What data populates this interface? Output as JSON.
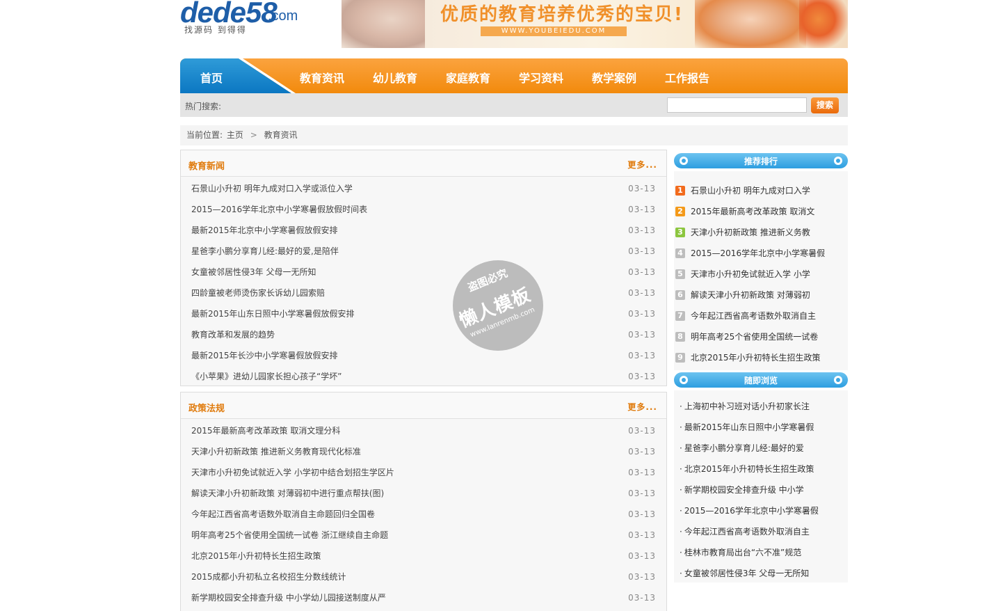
{
  "logo": {
    "brand": "dede58",
    "suffix": ".com",
    "slogan": "找源码 到得得"
  },
  "banner": {
    "headline": "优质的教育培养优秀的宝贝!",
    "url": "WWW.YOUBEIEDU.COM"
  },
  "nav": {
    "home": "首页",
    "items": [
      "教育资讯",
      "幼儿教育",
      "家庭教育",
      "学习资料",
      "教学案例",
      "工作报告"
    ]
  },
  "search": {
    "hot_label": "热门搜索:",
    "query": "",
    "button": "搜索"
  },
  "breadcrumb": {
    "prefix": "当前位置:",
    "home": "主页",
    "current": "教育资讯"
  },
  "news": {
    "title": "教育新闻",
    "more": "更多...",
    "items": [
      {
        "title": "石景山小升初 明年九成对口入学或派位入学",
        "date": "03-13"
      },
      {
        "title": "2015—2016学年北京中小学寒暑假放假时间表",
        "date": "03-13"
      },
      {
        "title": "最新2015年北京中小学寒暑假放假安排",
        "date": "03-13"
      },
      {
        "title": "星爸李小鹏分享育儿经:最好的爱,是陪伴",
        "date": "03-13"
      },
      {
        "title": "女童被邻居性侵3年 父母一无所知",
        "date": "03-13"
      },
      {
        "title": "四龄童被老师烫伤家长诉幼儿园索赔",
        "date": "03-13"
      },
      {
        "title": "最新2015年山东日照中小学寒暑假放假安排",
        "date": "03-13"
      },
      {
        "title": "教育改革和发展的趋势",
        "date": "03-13"
      },
      {
        "title": "最新2015年长沙中小学寒暑假放假安排",
        "date": "03-13"
      },
      {
        "title": "《小苹果》进幼儿园家长担心孩子“学坏”",
        "date": "03-13"
      }
    ]
  },
  "policy": {
    "title": "政策法规",
    "more": "更多...",
    "items": [
      {
        "title": "2015年最新高考改革政策 取消文理分科",
        "date": "03-13"
      },
      {
        "title": "天津小升初新政策 推进新义务教育现代化标准",
        "date": "03-13"
      },
      {
        "title": "天津市小升初免试就近入学 小学初中结合划招生学区片",
        "date": "03-13"
      },
      {
        "title": "解读天津小升初新政策 对薄弱初中进行重点帮扶(图)",
        "date": "03-13"
      },
      {
        "title": "今年起江西省高考语数外取消自主命题回归全国卷",
        "date": "03-13"
      },
      {
        "title": "明年高考25个省使用全国统一试卷 浙江继续自主命题",
        "date": "03-13"
      },
      {
        "title": "北京2015年小升初特长生招生政策",
        "date": "03-13"
      },
      {
        "title": "2015成都小升初私立名校招生分数线统计",
        "date": "03-13"
      },
      {
        "title": "新学期校园安全排查升级 中小学幼儿园接送制度从严",
        "date": "03-13"
      }
    ]
  },
  "ranking": {
    "title": "推荐排行",
    "items": [
      {
        "num": "1",
        "title": "石景山小升初 明年九成对口入学"
      },
      {
        "num": "2",
        "title": "2015年最新高考改革政策 取消文"
      },
      {
        "num": "3",
        "title": "天津小升初新政策 推进新义务教"
      },
      {
        "num": "4",
        "title": "2015—2016学年北京中小学寒暑假"
      },
      {
        "num": "5",
        "title": "天津市小升初免试就近入学 小学"
      },
      {
        "num": "6",
        "title": "解读天津小升初新政策 对薄弱初"
      },
      {
        "num": "7",
        "title": "今年起江西省高考语数外取消自主"
      },
      {
        "num": "8",
        "title": "明年高考25个省使用全国统一试卷"
      },
      {
        "num": "9",
        "title": "北京2015年小升初特长生招生政策"
      }
    ],
    "colors": [
      "#f26b1d",
      "#f49a1a",
      "#8cc63f",
      "#bdbdbd",
      "#bdbdbd",
      "#bdbdbd",
      "#bdbdbd",
      "#bdbdbd",
      "#bdbdbd"
    ]
  },
  "random": {
    "title": "随即浏览",
    "items": [
      "上海初中补习班对话小升初家长注",
      "最新2015年山东日照中小学寒暑假",
      "星爸李小鹏分享育儿经:最好的爱",
      "北京2015年小升初特长生招生政策",
      "新学期校园安全排查升级 中小学",
      "2015—2016学年北京中小学寒暑假",
      "今年起江西省高考语数外取消自主",
      "桂林市教育局出台“六不准”规范",
      "女童被邻居性侵3年 父母一无所知"
    ]
  },
  "watermark": {
    "line1": "盗图必究",
    "line2": "懒人模板",
    "line3": "www.lanrenmb.com"
  }
}
